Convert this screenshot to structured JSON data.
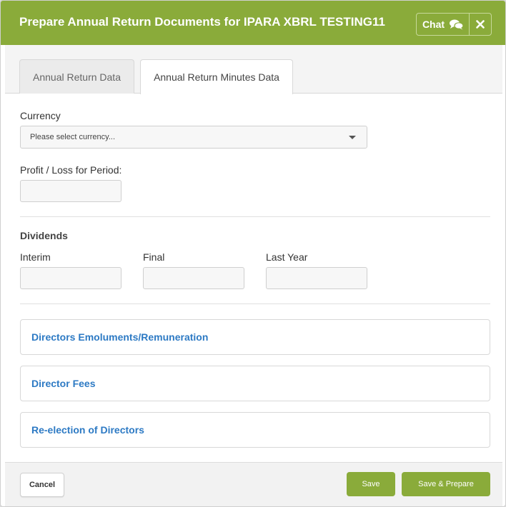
{
  "header": {
    "title": "Prepare Annual Return Documents for IPARA XBRL TESTING11",
    "chat_label": "Chat"
  },
  "tabs": [
    {
      "label": "Annual Return Data",
      "active": false
    },
    {
      "label": "Annual Return Minutes Data",
      "active": true
    }
  ],
  "form": {
    "currency_label": "Currency",
    "currency_placeholder": "Please select currency...",
    "profit_label": "Profit / Loss for Period:",
    "profit_value": "",
    "dividends_title": "Dividends",
    "interim_label": "Interim",
    "final_label": "Final",
    "last_year_label": "Last Year"
  },
  "sections": [
    {
      "label": "Directors Emoluments/Remuneration"
    },
    {
      "label": "Director Fees"
    },
    {
      "label": "Re-election of Directors"
    }
  ],
  "footer": {
    "cancel_label": "Cancel",
    "save_label": "Save",
    "save_prepare_label": "Save & Prepare"
  },
  "colors": {
    "accent": "#8aab3a",
    "link": "#2d7ac4"
  },
  "icons": {
    "chat": "chat-bubbles-icon",
    "close": "close-icon",
    "dropdown": "caret-down-icon"
  }
}
